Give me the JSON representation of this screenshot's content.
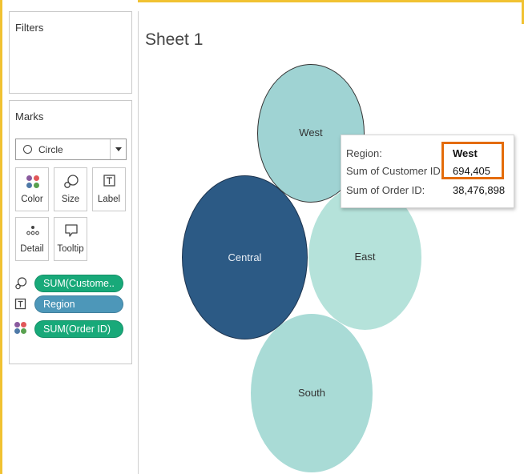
{
  "filters": {
    "title": "Filters"
  },
  "marks": {
    "title": "Marks",
    "mark_type": "Circle",
    "buttons": {
      "color": "Color",
      "size": "Size",
      "label": "Label",
      "detail": "Detail",
      "tooltip": "Tooltip"
    },
    "pills": [
      {
        "label": "SUM(Custome..",
        "role": "size",
        "color": "#18a979"
      },
      {
        "label": "Region",
        "role": "label",
        "color": "#4d97b9"
      },
      {
        "label": "SUM(Order ID)",
        "role": "color",
        "color": "#18a979"
      }
    ]
  },
  "sheet": {
    "title": "Sheet 1"
  },
  "bubbles": [
    {
      "region": "West",
      "color": "#9fd3d3"
    },
    {
      "region": "Central",
      "color": "#2c5a85"
    },
    {
      "region": "East",
      "color": "#b5e2da"
    },
    {
      "region": "South",
      "color": "#a9dbd6"
    }
  ],
  "tooltip": {
    "region_label": "Region:",
    "region_value": "West",
    "customer_label": "Sum of Customer ID:",
    "customer_value": "694,405",
    "order_label": "Sum of Order ID:",
    "order_value": "38,476,898",
    "highlight_color": "#e46c0a"
  }
}
